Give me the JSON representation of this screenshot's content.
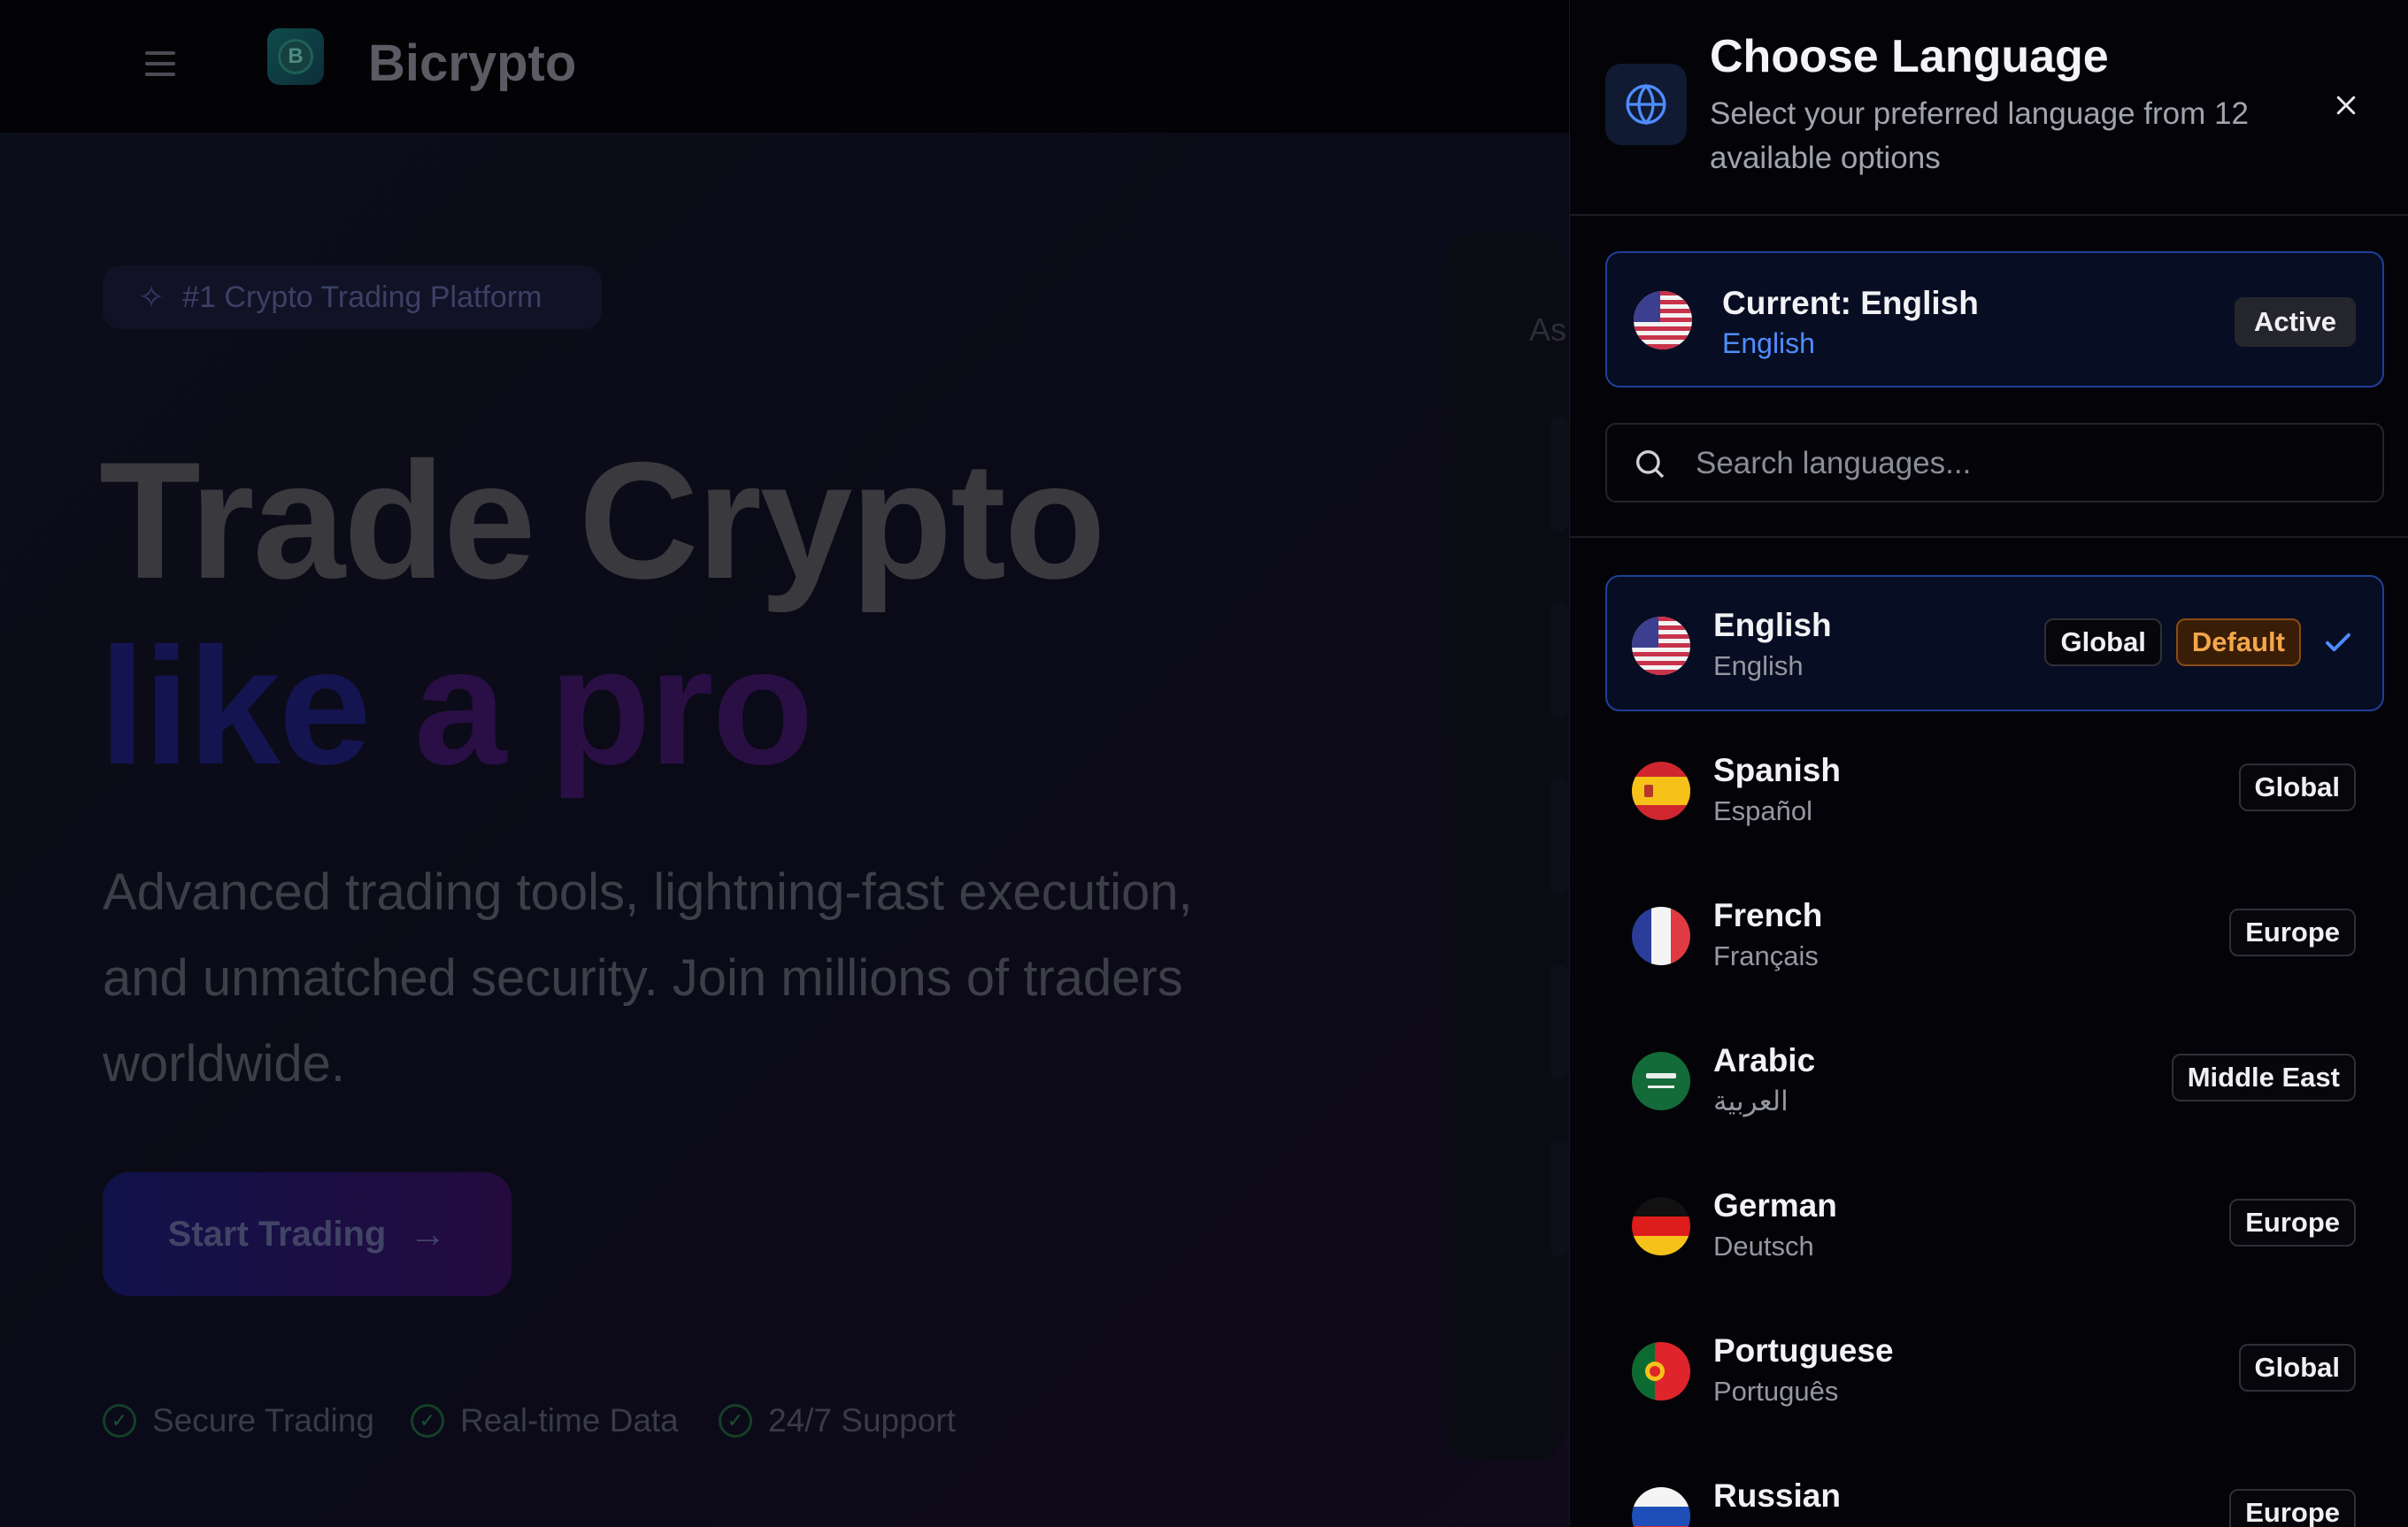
{
  "background": {
    "brand": "Bicrypto",
    "hero_pill": "#1 Crypto Trading Platform",
    "headline_1": "Trade Crypto",
    "headline_2_part1": "like",
    "headline_2_part2": "a",
    "headline_2_part3": "pro",
    "subtitle": "Advanced trading tools, lightning-fast execution, and unmatched security. Join millions of traders worldwide.",
    "cta_label": "Start Trading",
    "features": [
      "Secure Trading",
      "Real-time Data",
      "24/7 Support"
    ],
    "side_label": "As"
  },
  "panel": {
    "title": "Choose Language",
    "subtitle": "Select your preferred language from 12 available options",
    "current": {
      "label": "Current: English",
      "native": "English",
      "badge": "Active"
    },
    "search_placeholder": "Search languages...",
    "languages": [
      {
        "name": "English",
        "native": "English",
        "region": "Global",
        "default_badge": "Default",
        "selected": true,
        "flag": "us"
      },
      {
        "name": "Spanish",
        "native": "Español",
        "region": "Global",
        "flag": "es"
      },
      {
        "name": "French",
        "native": "Français",
        "region": "Europe",
        "flag": "fr"
      },
      {
        "name": "Arabic",
        "native": "العربية",
        "region": "Middle East",
        "flag": "sa"
      },
      {
        "name": "German",
        "native": "Deutsch",
        "region": "Europe",
        "flag": "de"
      },
      {
        "name": "Portuguese",
        "native": "Português",
        "region": "Global",
        "flag": "pt"
      },
      {
        "name": "Russian",
        "native": "",
        "region": "Europe",
        "flag": "ru"
      }
    ]
  },
  "colors": {
    "accent_blue": "#4f8cff",
    "selected_border": "#1f3f9a",
    "default_badge": "#f3a64b",
    "panel_bg": "#040408"
  }
}
